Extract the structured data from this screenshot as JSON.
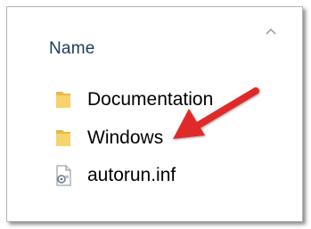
{
  "header": {
    "name_label": "Name"
  },
  "files": [
    {
      "label": "Documentation",
      "icon": "folder-icon"
    },
    {
      "label": "Windows",
      "icon": "folder-icon"
    },
    {
      "label": "autorun.inf",
      "icon": "settings-file-icon"
    }
  ],
  "colors": {
    "header_text": "#1e395b",
    "folder_yellow": "#f6d36b",
    "arrow_red": "#e02a2a"
  }
}
